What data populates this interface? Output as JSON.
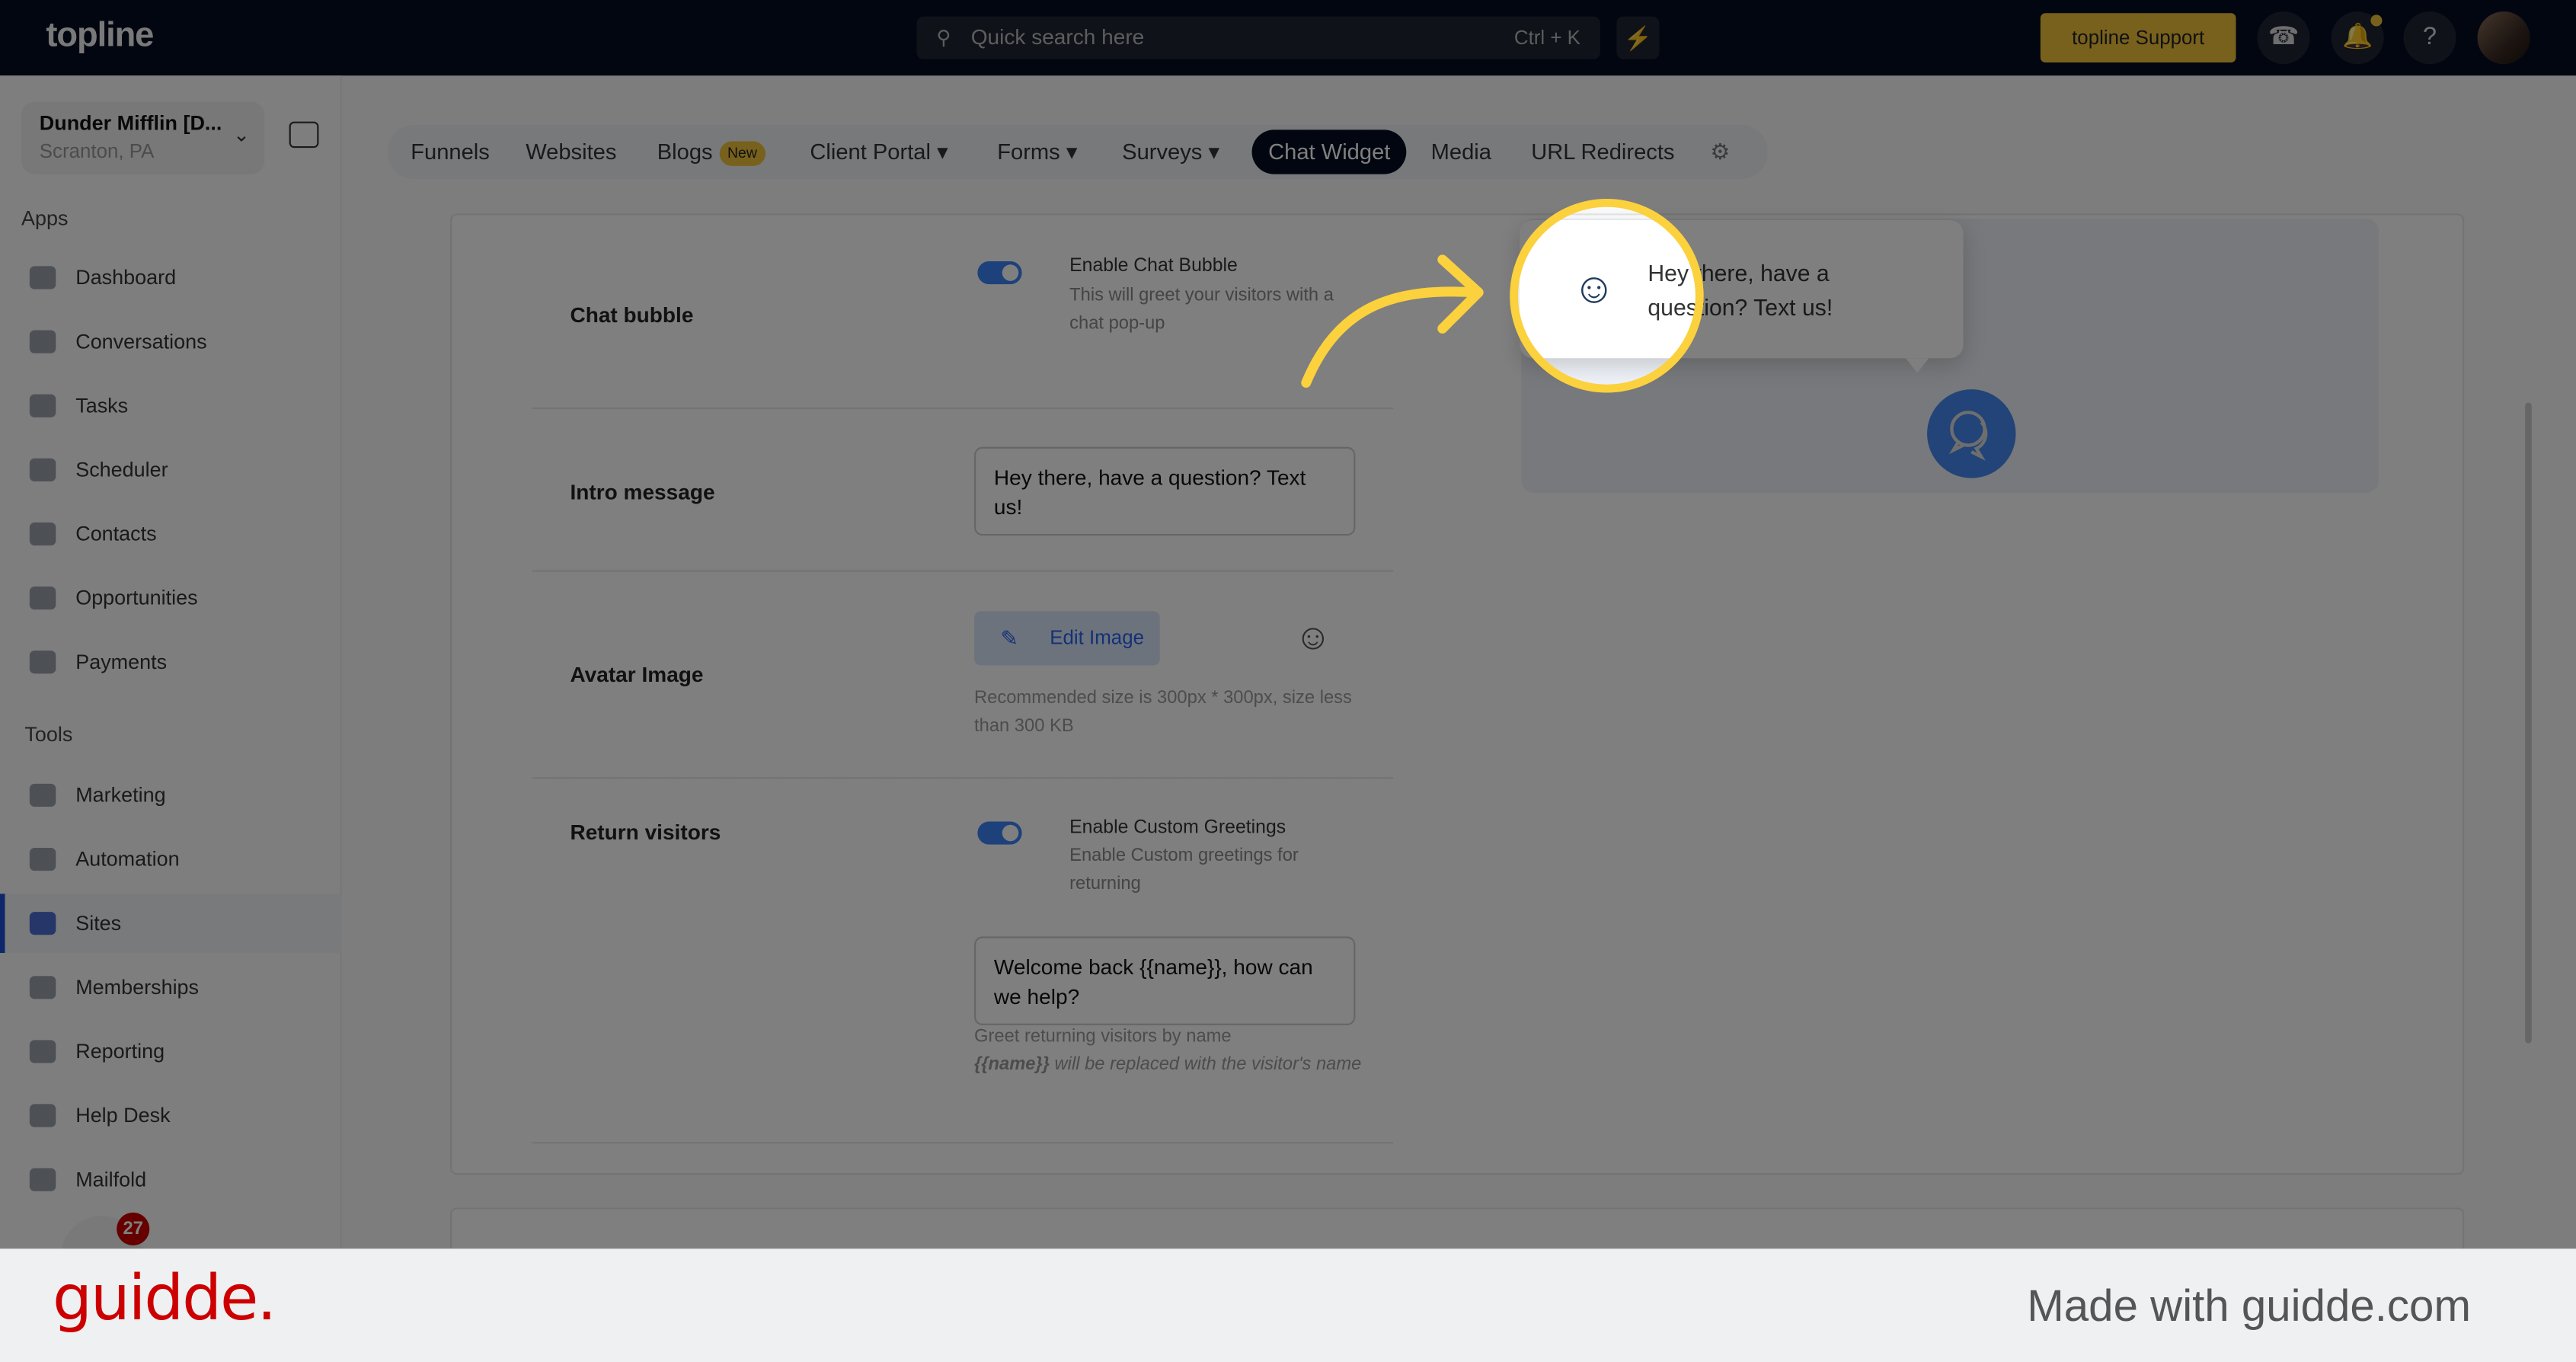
{
  "topbar": {
    "logo": "topline",
    "search_placeholder": "Quick search here",
    "search_shortcut": "Ctrl + K",
    "support_label": "topline Support",
    "colors": {
      "bg": "#050b20",
      "accent": "#f0c33a"
    }
  },
  "account": {
    "name": "Dunder Mifflin [D...",
    "location": "Scranton, PA"
  },
  "sidebar": {
    "apps_label": "Apps",
    "tools_label": "Tools",
    "apps": [
      {
        "label": "Dashboard"
      },
      {
        "label": "Conversations"
      },
      {
        "label": "Tasks"
      },
      {
        "label": "Scheduler"
      },
      {
        "label": "Contacts"
      },
      {
        "label": "Opportunities"
      },
      {
        "label": "Payments"
      }
    ],
    "tools": [
      {
        "label": "Marketing"
      },
      {
        "label": "Automation"
      },
      {
        "label": "Sites",
        "active": true
      },
      {
        "label": "Memberships"
      },
      {
        "label": "Reporting"
      },
      {
        "label": "Help Desk"
      },
      {
        "label": "Mailfold"
      }
    ],
    "notification_count": "27"
  },
  "tabs": [
    {
      "label": "Funnels"
    },
    {
      "label": "Websites"
    },
    {
      "label": "Blogs",
      "badge": "New"
    },
    {
      "label": "Client Portal"
    },
    {
      "label": "Forms"
    },
    {
      "label": "Surveys"
    },
    {
      "label": "Chat Widget",
      "active": true
    },
    {
      "label": "Media"
    },
    {
      "label": "URL Redirects"
    }
  ],
  "settings": {
    "chat_bubble": {
      "label": "Chat bubble",
      "option_title": "Enable Chat Bubble",
      "option_desc": "This will greet your visitors with a chat pop-up",
      "enabled": true
    },
    "intro": {
      "label": "Intro message",
      "value": "Hey there, have a question? Text us!"
    },
    "avatar": {
      "label": "Avatar Image",
      "button": "Edit Image",
      "help": "Recommended size is 300px * 300px, size less than 300 KB"
    },
    "return": {
      "label": "Return visitors",
      "option_title": "Enable Custom Greetings",
      "option_desc": "Enable Custom greetings for returning",
      "enabled": true,
      "value": "Welcome back {{name}}, how can we help?",
      "help1": "Greet returning visitors by name",
      "help_var": "{{name}}",
      "help2": " will be replaced with the visitor's name"
    }
  },
  "preview": {
    "bubble_text": "Hey there, have a question? Text us!",
    "button_color": "#4489f0"
  },
  "footer": {
    "brand": "guidde.",
    "tagline": "Made with guidde.com",
    "brand_color": "#cc0000"
  },
  "highlight_color": "#fbd13d"
}
